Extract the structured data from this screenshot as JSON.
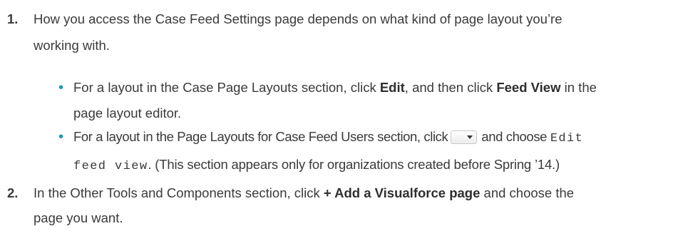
{
  "steps": [
    {
      "number": "1.",
      "text_line1": "How you access the Case Feed Settings page depends on what kind of page layout you’re",
      "text_line2": "working with.",
      "bullets": [
        {
          "part1": "For a layout in the Case Page Layouts section, click ",
          "bold1": "Edit",
          "part2": ", and then click ",
          "bold2": "Feed View",
          "part3": " in the",
          "line2": "page layout editor."
        },
        {
          "part1": "For a layout in the Page Layouts for Case Feed Users section, click",
          "part2": "and choose",
          "mono1": "Edit",
          "mono2": "feed view",
          "part3": ". (This section appears only for organizations created before Spring ’14.)"
        }
      ]
    },
    {
      "number": "2.",
      "part1": "In the Other Tools and Components section, click ",
      "bold1": "+ Add a Visualforce page",
      "part2": " and choose the",
      "line2": "page you want."
    }
  ],
  "colors": {
    "text": "#3a3a3a",
    "bullet": "#1798c1"
  },
  "icons": {
    "menu_button": "dropdown-menu-button-icon"
  }
}
